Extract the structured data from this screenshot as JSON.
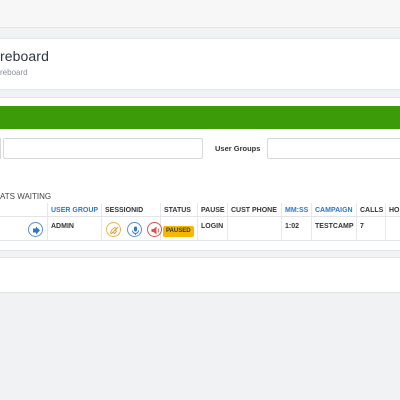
{
  "header": {
    "title": "reboard",
    "breadcrumb": "reboard"
  },
  "filters": {
    "user_groups_label": "User Groups"
  },
  "status": {
    "waiting_text": "ATS WAITING"
  },
  "table": {
    "columns": [
      {
        "label": "USER GROUP",
        "color": "#2f76c6"
      },
      {
        "label": "SESSIONID"
      },
      {
        "label": "STATUS"
      },
      {
        "label": "PAUSE"
      },
      {
        "label": "CUST PHONE"
      },
      {
        "label": "MM:SS",
        "color": "#2f76c6"
      },
      {
        "label": "CAMPAIGN",
        "color": "#2f76c6"
      },
      {
        "label": "CALLS"
      },
      {
        "label": "HO"
      }
    ],
    "rows": [
      {
        "user_group": "ADMIN",
        "status": "PAUSED",
        "pause": "LOGIN",
        "cust_phone": "",
        "mmss": "1:02",
        "campaign": "TESTCAMP",
        "calls": "7",
        "icons": [
          "logout-icon",
          "hangup-icon",
          "listen-icon",
          "barge-icon"
        ]
      }
    ]
  },
  "colors": {
    "green_bar": "#3c9b08",
    "paused_badge": "#f5b700",
    "link_blue": "#2f76c6"
  }
}
